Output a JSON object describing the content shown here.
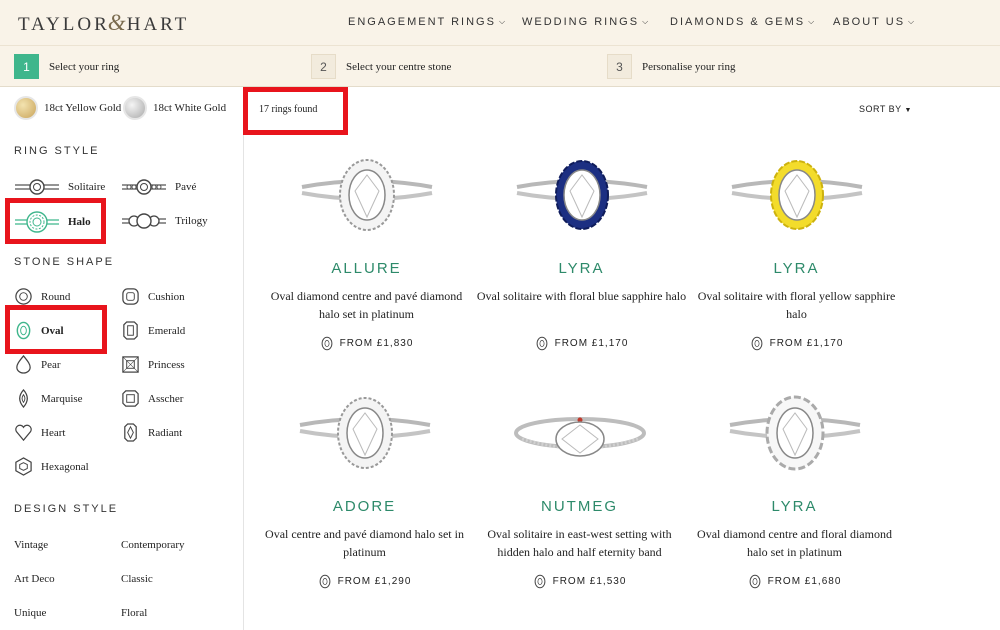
{
  "brand": {
    "left": "TAYLOR",
    "amp": "&",
    "right": "HART"
  },
  "nav": [
    {
      "label": "ENGAGEMENT RINGS"
    },
    {
      "label": "WEDDING RINGS"
    },
    {
      "label": "DIAMONDS & GEMS"
    },
    {
      "label": "ABOUT US"
    }
  ],
  "steps": [
    {
      "num": "1",
      "label": "Select your ring",
      "active": true
    },
    {
      "num": "2",
      "label": "Select your centre stone"
    },
    {
      "num": "3",
      "label": "Personalise your ring"
    }
  ],
  "metals": [
    {
      "label": "18ct Yellow Gold",
      "color": "#d9c07e"
    },
    {
      "label": "18ct White Gold",
      "color": "#cfcfcf"
    }
  ],
  "ring_style": {
    "title": "RING STYLE",
    "options": [
      {
        "label": "Solitaire",
        "icon": "solitaire-ring-icon"
      },
      {
        "label": "Pavé",
        "icon": "pave-ring-icon"
      },
      {
        "label": "Halo",
        "icon": "halo-ring-icon",
        "selected": true
      },
      {
        "label": "Trilogy",
        "icon": "trilogy-ring-icon"
      }
    ]
  },
  "stone_shape": {
    "title": "STONE SHAPE",
    "options": [
      {
        "label": "Round",
        "icon": "round-shape-icon"
      },
      {
        "label": "Cushion",
        "icon": "cushion-shape-icon"
      },
      {
        "label": "Oval",
        "icon": "oval-shape-icon",
        "selected": true
      },
      {
        "label": "Emerald",
        "icon": "emerald-shape-icon"
      },
      {
        "label": "Pear",
        "icon": "pear-shape-icon"
      },
      {
        "label": "Princess",
        "icon": "princess-shape-icon"
      },
      {
        "label": "Marquise",
        "icon": "marquise-shape-icon"
      },
      {
        "label": "Asscher",
        "icon": "asscher-shape-icon"
      },
      {
        "label": "Heart",
        "icon": "heart-shape-icon"
      },
      {
        "label": "Radiant",
        "icon": "radiant-shape-icon"
      },
      {
        "label": "Hexagonal",
        "icon": "hexagonal-shape-icon"
      }
    ]
  },
  "design_style": {
    "title": "DESIGN STYLE",
    "options": [
      "Vintage",
      "Contemporary",
      "Art Deco",
      "Classic",
      "Unique",
      "Floral"
    ]
  },
  "results": {
    "count_label": "17 rings found",
    "sort_label": "SORT BY"
  },
  "accent_color": "#2d8a6a",
  "highlight_color": "#e8141c",
  "products": [
    {
      "name": "ALLURE",
      "desc": "Oval diamond centre and pavé diamond halo set in platinum",
      "price": "FROM £1,830",
      "halo": "diamond"
    },
    {
      "name": "LYRA",
      "desc": "Oval solitaire with floral blue sapphire halo",
      "price": "FROM £1,170",
      "halo": "sapphire"
    },
    {
      "name": "LYRA",
      "desc": "Oval solitaire with floral yellow sapphire halo",
      "price": "FROM £1,170",
      "halo": "yellow"
    },
    {
      "name": "ADORE",
      "desc": "Oval centre and pavé diamond halo set in platinum",
      "price": "FROM £1,290",
      "halo": "diamond"
    },
    {
      "name": "NUTMEG",
      "desc": "Oval solitaire in east-west setting with hidden halo and half eternity band",
      "price": "FROM £1,530",
      "halo": "eastwest"
    },
    {
      "name": "LYRA",
      "desc": "Oval diamond centre and floral diamond halo set in platinum",
      "price": "FROM £1,680",
      "halo": "floral"
    }
  ]
}
